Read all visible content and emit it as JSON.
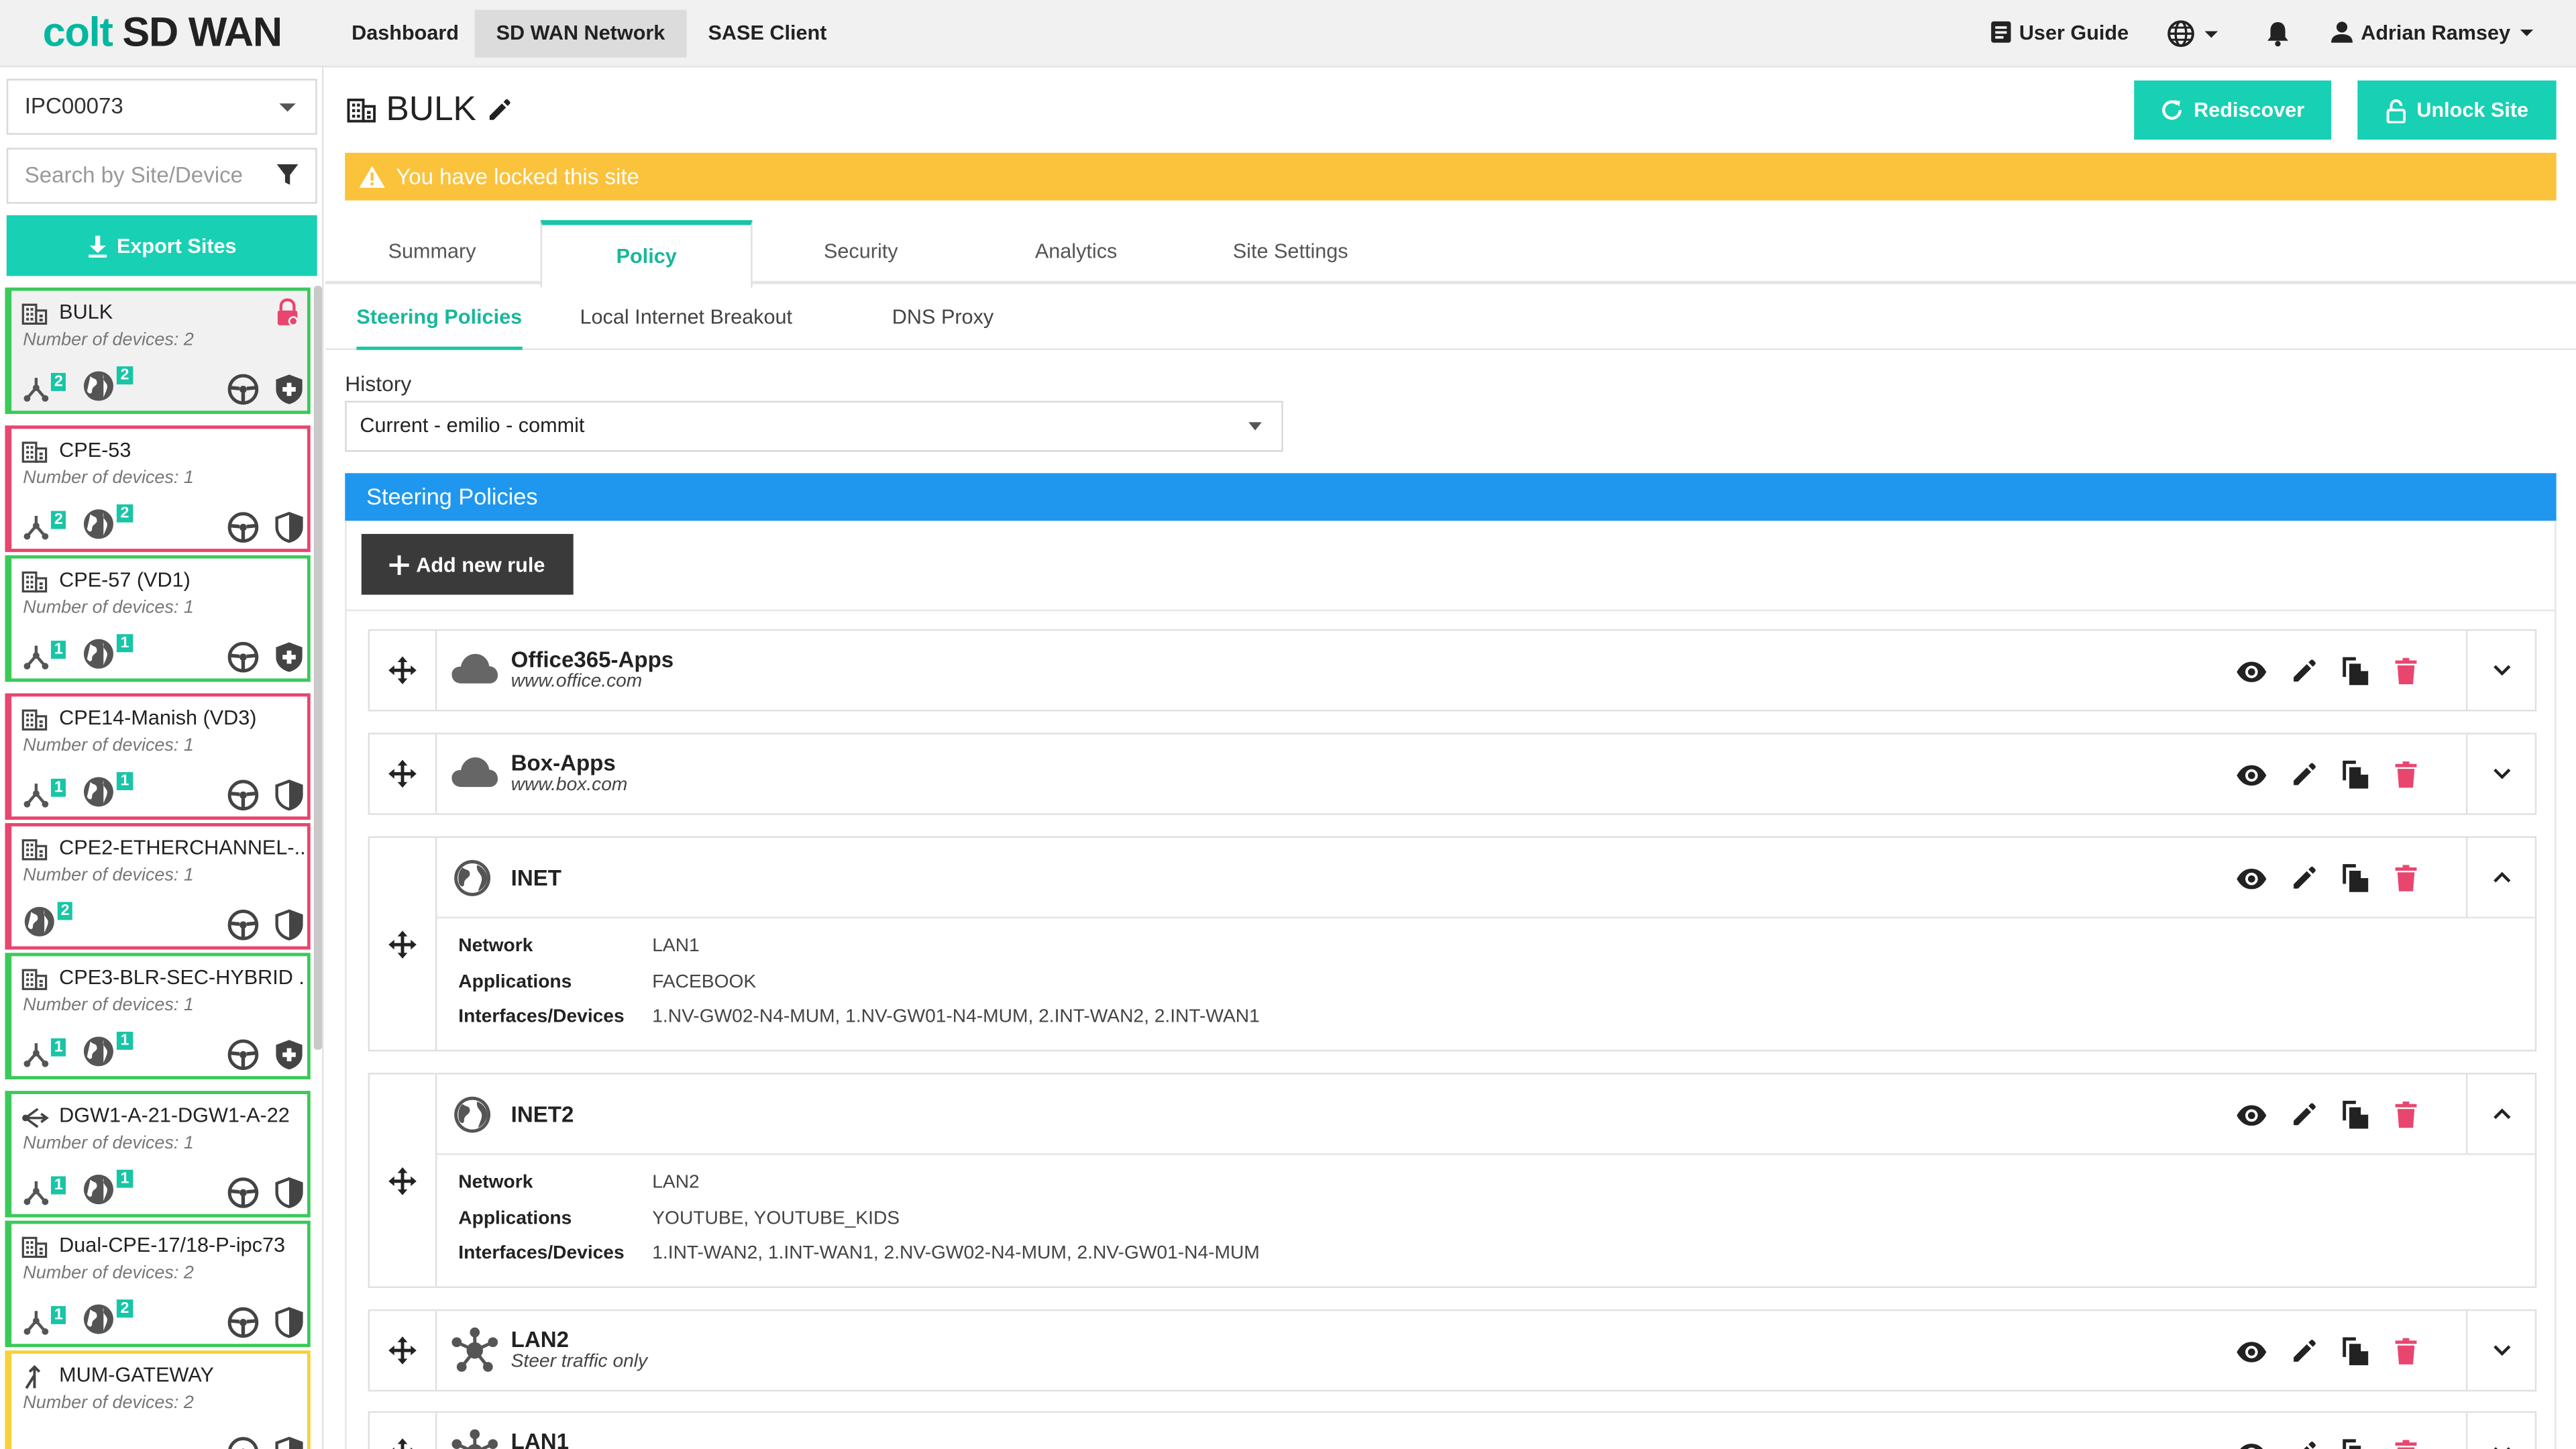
{
  "topbar": {
    "brand_colt": "colt",
    "brand_sdwan": "SD WAN",
    "nav": [
      "Dashboard",
      "SD WAN Network",
      "SASE Client"
    ],
    "user_guide": "User Guide",
    "user_name": "Adrian Ramsey"
  },
  "sidebar": {
    "customer_select": "IPC00073",
    "search_placeholder": "Search by Site/Device",
    "export_label": "Export Sites",
    "sites": [
      {
        "name": "BULK",
        "devices": "Number of devices: 2",
        "badge1": "2",
        "badge2": "2",
        "status": "selected"
      },
      {
        "name": "CPE-53",
        "devices": "Number of devices: 1",
        "badge1": "2",
        "badge2": "2",
        "status": "red"
      },
      {
        "name": "CPE-57 (VD1)",
        "devices": "Number of devices: 1",
        "badge1": "1",
        "badge2": "1",
        "status": "green"
      },
      {
        "name": "CPE14-Manish (VD3)",
        "devices": "Number of devices: 1",
        "badge1": "1",
        "badge2": "1",
        "status": "red"
      },
      {
        "name": "CPE2-ETHERCHANNEL-...",
        "devices": "Number of devices: 1",
        "badge2": "2",
        "status": "red"
      },
      {
        "name": "CPE3-BLR-SEC-HYBRID ...",
        "devices": "Number of devices: 1",
        "badge1": "1",
        "badge2": "1",
        "status": "green"
      },
      {
        "name": "DGW1-A-21-DGW1-A-22",
        "devices": "Number of devices: 1",
        "badge1": "1",
        "badge2": "1",
        "status": "green"
      },
      {
        "name": "Dual-CPE-17/18-P-ipc73",
        "devices": "Number of devices: 2",
        "badge1": "1",
        "badge2": "2",
        "status": "green"
      },
      {
        "name": "MUM-GATEWAY",
        "devices": "Number of devices: 2",
        "status": "yellow"
      }
    ]
  },
  "main": {
    "title": "BULK",
    "rediscover": "Rediscover",
    "unlock": "Unlock Site",
    "lock_banner": "You have locked this site",
    "tabs": [
      "Summary",
      "Policy",
      "Security",
      "Analytics",
      "Site Settings"
    ],
    "subtabs": [
      "Steering Policies",
      "Local Internet Breakout",
      "DNS Proxy"
    ],
    "history_label": "History",
    "history_value": "Current - emilio - commit",
    "section_title": "Steering Policies",
    "add_rule": "Add new rule",
    "detail_labels": {
      "network": "Network",
      "applications": "Applications",
      "interfaces": "Interfaces/Devices"
    },
    "rules": [
      {
        "name": "Office365-Apps",
        "sub": "www.office.com",
        "icon": "cloud-icon"
      },
      {
        "name": "Box-Apps",
        "sub": "www.box.com",
        "icon": "cloud-icon"
      },
      {
        "name": "INET",
        "icon": "globe-icon",
        "network": "LAN1",
        "applications": "FACEBOOK",
        "interfaces": "1.NV-GW02-N4-MUM, 1.NV-GW01-N4-MUM, 2.INT-WAN2, 2.INT-WAN1"
      },
      {
        "name": "INET2",
        "icon": "globe-icon",
        "network": "LAN2",
        "applications": "YOUTUBE, YOUTUBE_KIDS",
        "interfaces": "1.INT-WAN2, 1.INT-WAN1, 2.NV-GW02-N4-MUM, 2.NV-GW01-N4-MUM"
      },
      {
        "name": "LAN2",
        "sub": "Steer traffic only",
        "icon": "hub-icon"
      },
      {
        "name": "LAN1",
        "icon": "hub-icon"
      }
    ]
  },
  "colors": {
    "teal": "#18d0b3",
    "blue": "#1f97ef",
    "warning": "#fbc23c",
    "danger": "#e8466f",
    "ok": "#3bc95a"
  }
}
